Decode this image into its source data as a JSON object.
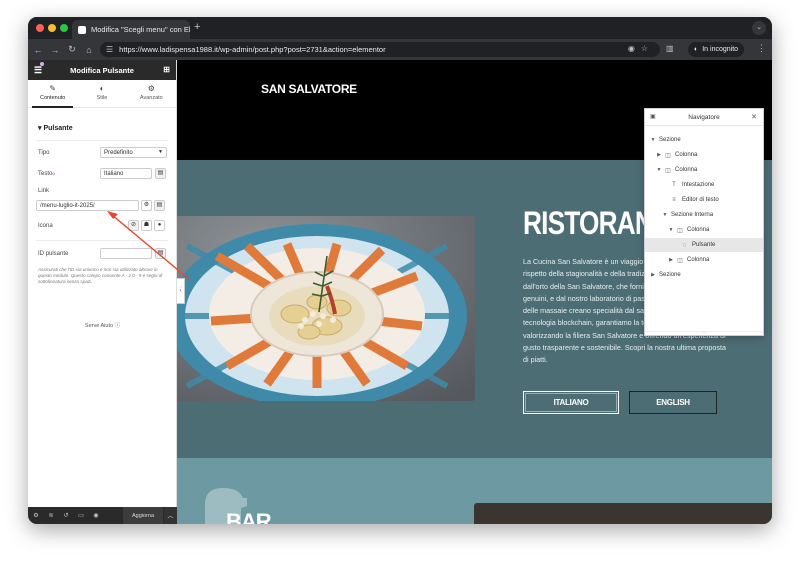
{
  "browser": {
    "tab_title": "Modifica \"Scegli menu\" con Elementor",
    "url": "https://www.ladispensa1988.it/wp-admin/post.php?post=2731&action=elementor",
    "incognito_label": "In incognito"
  },
  "panel": {
    "title": "Modifica Pulsante",
    "tabs": [
      {
        "label": "Contenuto"
      },
      {
        "label": "Stile"
      },
      {
        "label": "Avanzato"
      }
    ],
    "section_title": "Pulsante",
    "type_label": "Tipo",
    "type_value": "Predefinito",
    "text_label": "Testo",
    "text_value": "Italiano",
    "link_label": "Link",
    "link_value": "/menu-luglio-it-2025/",
    "icon_label": "Icona",
    "id_label": "ID pulsante",
    "id_value": "",
    "id_help": "Assicurati che l'ID sia univoco e non sia utilizzato altrove in questo modulo. Questo campo consente A - z   0 - 9 e segni di sottolineatura senza spazi.",
    "need_help": "Serve Aiuto",
    "update_label": "Aggiorna"
  },
  "preview": {
    "brand": "SAN SALVATORE",
    "restaurant_title": "RISTORANTE",
    "restaurant_text": "La Cucina San Salvatore è un viaggio nei sapori del Cilento, nel rispetto della stagionalità e della tradizione. Ogni piatto nasce dall'orto della San Salvatore, che fornisce ortaggi freschi e genuini, e dal nostro laboratorio di pasta, dove le mani esperte delle massaie creano specialità dal sapore unico. Grazie alla tecnologia blockchain, garantiamo la totale tracciabilità del menu, valorizzando la filiera San Salvatore e offrendo un'esperienza di gusto trasparente e sostenibile. Scopri la nostra ultima proposta di piatti.",
    "button_italian": "ITALIANO",
    "button_english": "ENGLISH",
    "bar_title": "BAR"
  },
  "navigator": {
    "title": "Navigatore",
    "items": [
      {
        "label": "Sezione"
      },
      {
        "label": "Colonna"
      },
      {
        "label": "Colonna"
      },
      {
        "label": "Intestazione"
      },
      {
        "label": "Editor di testo"
      },
      {
        "label": "Sezione Interna"
      },
      {
        "label": "Colonna"
      },
      {
        "label": "Pulsante"
      },
      {
        "label": "Colonna"
      },
      {
        "label": "Sezione"
      }
    ]
  }
}
